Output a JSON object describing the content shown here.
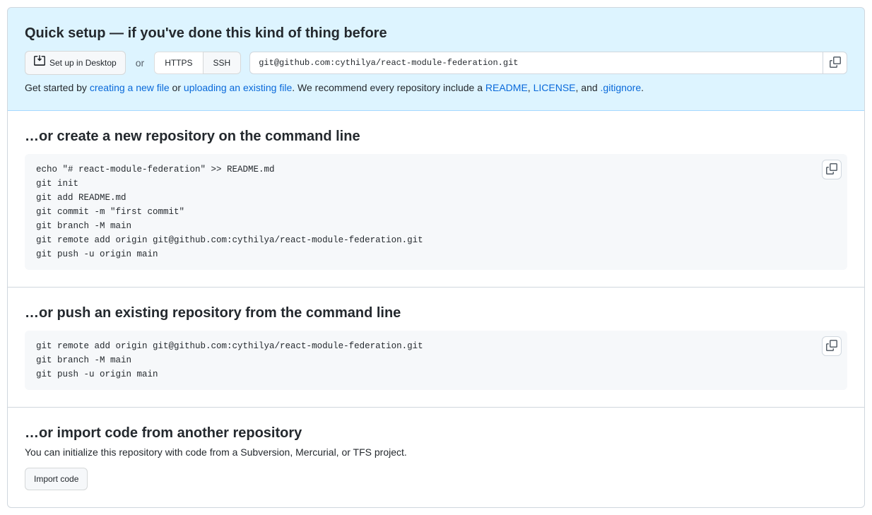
{
  "quick_setup": {
    "title": "Quick setup — if you've done this kind of thing before",
    "desktop_button": "Set up in Desktop",
    "or_text": "or",
    "protocol_https": "HTTPS",
    "protocol_ssh": "SSH",
    "clone_url": "git@github.com:cythilya/react-module-federation.git",
    "helper_prefix": "Get started by ",
    "link_new_file": "creating a new file",
    "helper_or": " or ",
    "link_upload": "uploading an existing file",
    "helper_mid": ". We recommend every repository include a ",
    "link_readme": "README",
    "helper_comma": ", ",
    "link_license": "LICENSE",
    "helper_and": ", and ",
    "link_gitignore": ".gitignore",
    "helper_end": "."
  },
  "create_new": {
    "title": "…or create a new repository on the command line",
    "code": "echo \"# react-module-federation\" >> README.md\ngit init\ngit add README.md\ngit commit -m \"first commit\"\ngit branch -M main\ngit remote add origin git@github.com:cythilya/react-module-federation.git\ngit push -u origin main"
  },
  "push_existing": {
    "title": "…or push an existing repository from the command line",
    "code": "git remote add origin git@github.com:cythilya/react-module-federation.git\ngit branch -M main\ngit push -u origin main"
  },
  "import_code": {
    "title": "…or import code from another repository",
    "description": "You can initialize this repository with code from a Subversion, Mercurial, or TFS project.",
    "button": "Import code"
  }
}
